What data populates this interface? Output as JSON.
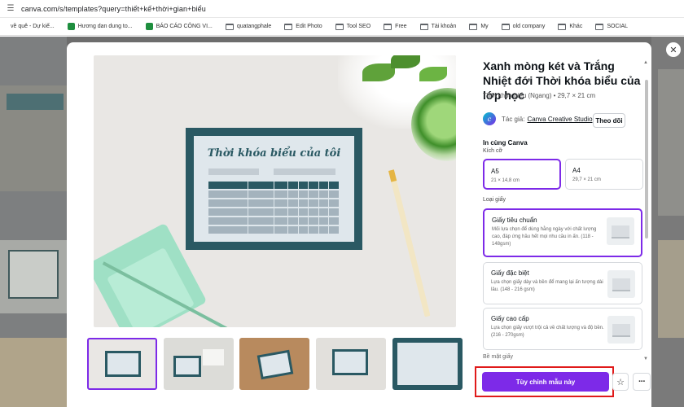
{
  "browser": {
    "url": "canva.com/s/templates?query=thiết+kế+thời+gian+biểu",
    "bookmarks": [
      {
        "label": "về quê - Dự kiế...",
        "icon": "page-icon"
      },
      {
        "label": "Hương dan dung to...",
        "icon": "sheets-icon"
      },
      {
        "label": "BÁO CÁO CÔNG VI...",
        "icon": "sheets-icon"
      },
      {
        "label": "quatangphale",
        "icon": "folder-icon"
      },
      {
        "label": "Edit Photo",
        "icon": "folder-icon"
      },
      {
        "label": "Tool SEO",
        "icon": "folder-icon"
      },
      {
        "label": "Free",
        "icon": "folder-icon"
      },
      {
        "label": "Tài khoản",
        "icon": "folder-icon"
      },
      {
        "label": "My",
        "icon": "folder-icon"
      },
      {
        "label": "old company",
        "icon": "folder-icon"
      },
      {
        "label": "Khác",
        "icon": "folder-icon"
      },
      {
        "label": "SOCIAL",
        "icon": "folder-icon"
      }
    ]
  },
  "template": {
    "title": "Xanh mòng két và Trắng Nhiệt đới Thời khóa biểu của lớp học",
    "subtitle": "Thời khóa biểu (Ngang) • 29,7 × 21 cm",
    "preview_heading": "Thời khóa biểu của tôi",
    "author_label": "Tác giả:",
    "author_name": "Canva Creative Studio",
    "follow_label": "Theo dõi"
  },
  "print": {
    "heading": "In cùng Canva",
    "size_label": "Kích cỡ",
    "sizes": [
      {
        "name": "A5",
        "dim": "21 × 14,8 cm",
        "selected": true
      },
      {
        "name": "A4",
        "dim": "29,7 × 21 cm",
        "selected": false
      }
    ],
    "paper_label": "Loại giấy",
    "papers": [
      {
        "name": "Giấy tiêu chuẩn",
        "desc": "Mối lựa chọn để dùng hằng ngày với chất lượng cao, đáp ứng hầu hết mọi nhu cầu in ấn. (118 - 148gsm)",
        "selected": true
      },
      {
        "name": "Giấy đặc biệt",
        "desc": "Lựa chọn giấy dày và bền để mang lại ấn tượng dài lâu. (148 - 216 gsm)",
        "selected": false
      },
      {
        "name": "Giấy cao cấp",
        "desc": "Lựa chọn giấy vượt trội cả về chất lượng và độ bền. (216 - 270gsm)",
        "selected": false
      }
    ],
    "more_paper": "Bề mặt giấy"
  },
  "actions": {
    "customize_label": "Tùy chỉnh mẫu này",
    "close_icon": "close-icon",
    "star_icon": "star-icon",
    "more_icon": "more-icon"
  },
  "colors": {
    "accent": "#7d2ae8",
    "highlight": "#e01a1a",
    "teal": "#2a5963"
  }
}
